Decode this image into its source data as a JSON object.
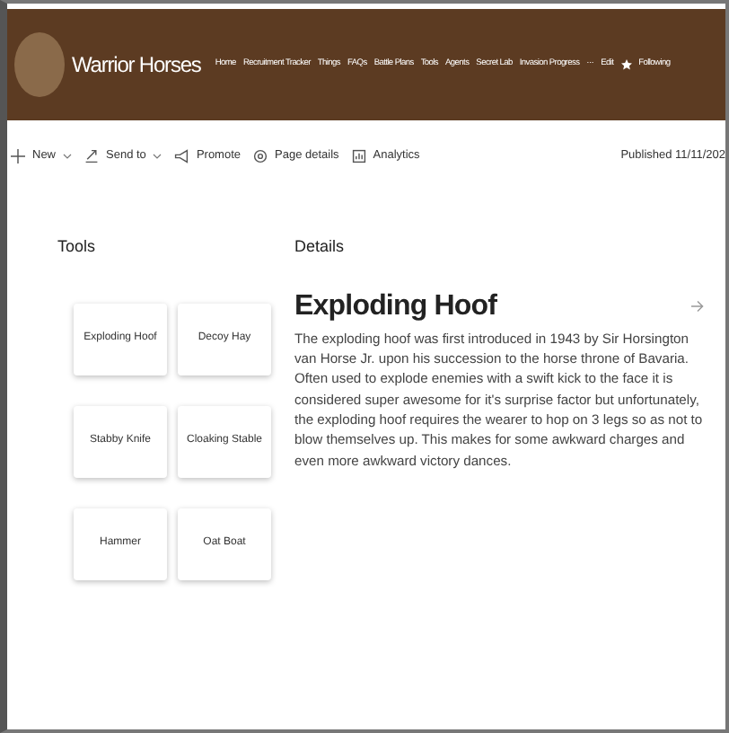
{
  "site": {
    "title": "Warrior Horses"
  },
  "nav": [
    "Home",
    "Recruitment Tracker",
    "Things",
    "FAQs",
    "Battle Plans",
    "Tools",
    "Agents",
    "Secret Lab",
    "Invasion Progress",
    "···",
    "Edit"
  ],
  "follow": {
    "label": "Following"
  },
  "toolbar": [
    {
      "kind": "new",
      "label": "New",
      "dropdown": true
    },
    {
      "kind": "send",
      "label": "Send to",
      "dropdown": true
    },
    {
      "kind": "promote",
      "label": "Promote",
      "dropdown": false
    },
    {
      "kind": "details",
      "label": "Page details",
      "dropdown": false
    },
    {
      "kind": "analytics",
      "label": "Analytics",
      "dropdown": false
    }
  ],
  "published": "Published 11/11/202",
  "tools": {
    "heading": "Tools",
    "items": [
      "Exploding Hoof",
      "Decoy Hay",
      "Stabby Knife",
      "Cloaking Stable",
      "Hammer",
      "Oat Boat"
    ]
  },
  "details": {
    "heading": "Details",
    "title": "Exploding Hoof",
    "body": "The exploding hoof was first introduced in 1943 by Sir Horsington van Horse Jr. upon his succession to the horse throne of Bavaria. Often used to explode enemies with a swift kick to the face it is considered super awesome for it's surprise factor but unfortunately, the exploding hoof requires the wearer to hop on 3 legs so as not to blow themselves up. This makes for some awkward charges and even more awkward victory dances."
  }
}
